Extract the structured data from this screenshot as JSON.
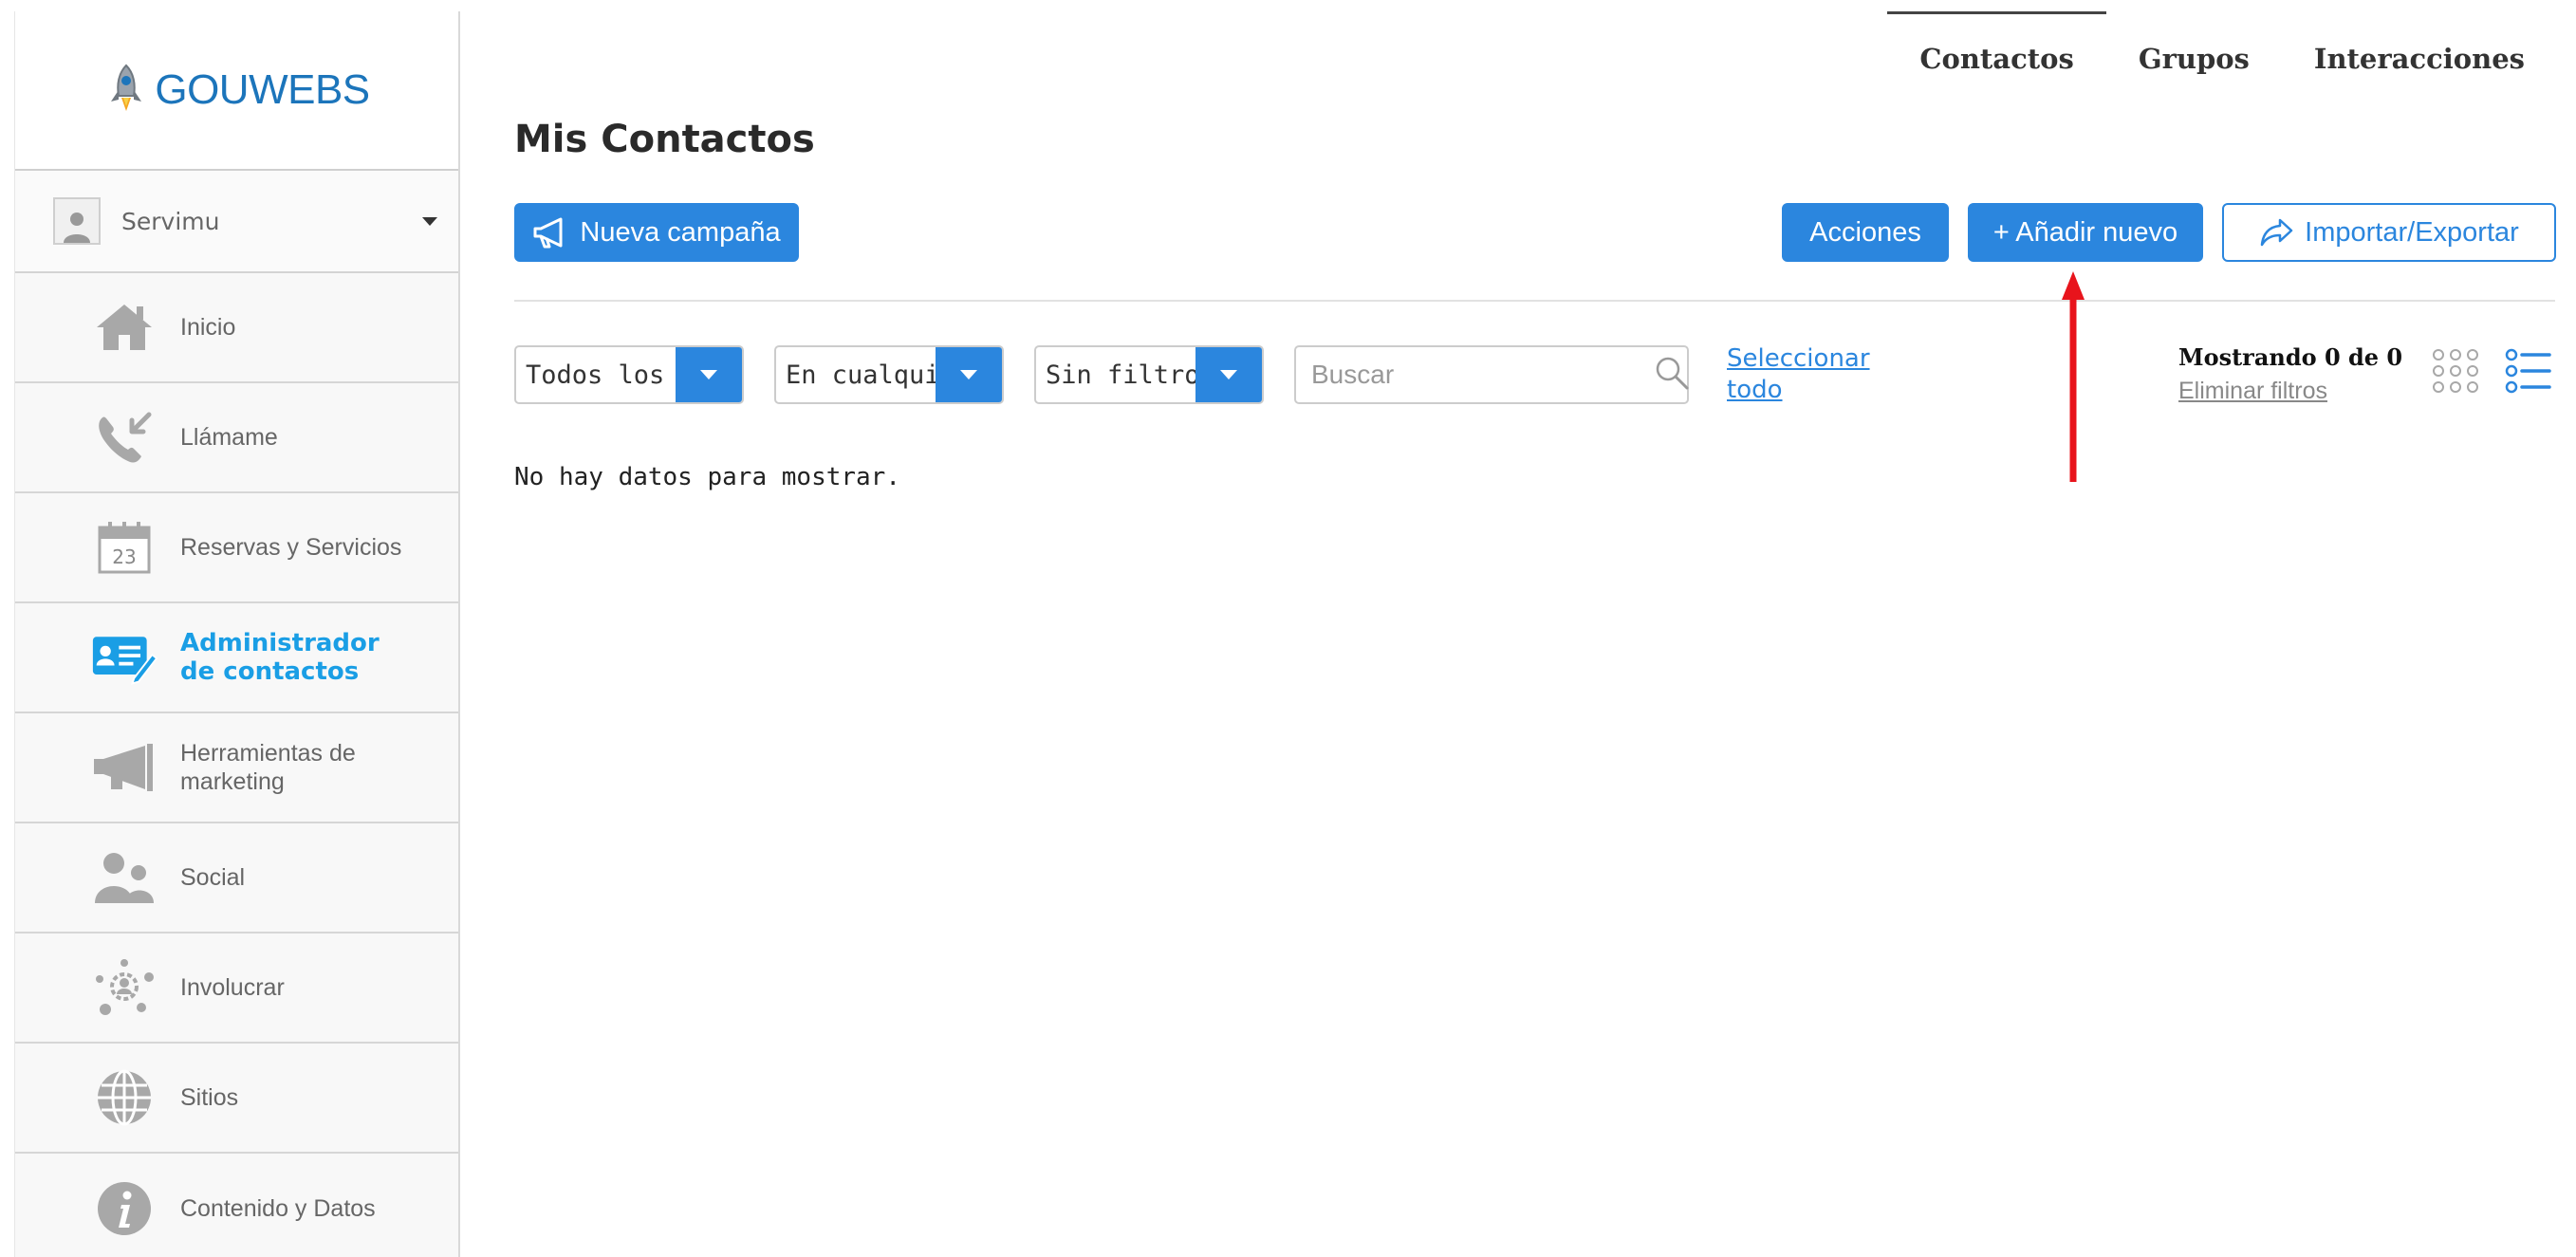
{
  "brand": {
    "logo_text": "GOUWEBS"
  },
  "user": {
    "name": "Servimu"
  },
  "sidebar": {
    "items": [
      {
        "label": "Inicio",
        "icon": "home-icon"
      },
      {
        "label": "Llámame",
        "icon": "phone-icon"
      },
      {
        "label": "Reservas y Servicios",
        "icon": "calendar-icon",
        "calendar_day": "23"
      },
      {
        "label": "Administrador de contactos",
        "icon": "contacts-card-icon",
        "active": true
      },
      {
        "label": "Herramientas de marketing",
        "icon": "megaphone-icon"
      },
      {
        "label": "Social",
        "icon": "people-icon"
      },
      {
        "label": "Involucrar",
        "icon": "network-icon"
      },
      {
        "label": "Sitios",
        "icon": "globe-icon"
      },
      {
        "label": "Contenido y Datos",
        "icon": "info-icon"
      }
    ]
  },
  "tabs": {
    "contacts": "Contactos",
    "groups": "Grupos",
    "interactions": "Interacciones",
    "active": "Contactos"
  },
  "main": {
    "title": "Mis Contactos",
    "new_campaign": "Nueva campaña",
    "actions": "Acciones",
    "add_new": "+ Añadir nuevo",
    "import_export": "Importar/Exportar"
  },
  "filters": {
    "groups": "Todos los grupos",
    "match": "En cualquier",
    "filter": "Sin filtro",
    "search_placeholder": "Buscar",
    "select_all_line1": "Seleccionar",
    "select_all_line2": "todo",
    "showing": "Mostrando 0 de 0",
    "clear": "Eliminar filtros"
  },
  "empty_message": "No hay datos para mostrar.",
  "colors": {
    "accent": "#2b86de",
    "active_nav": "#1a9ee5",
    "logo": "#1c75bb",
    "annotation_arrow": "#e8141c"
  }
}
